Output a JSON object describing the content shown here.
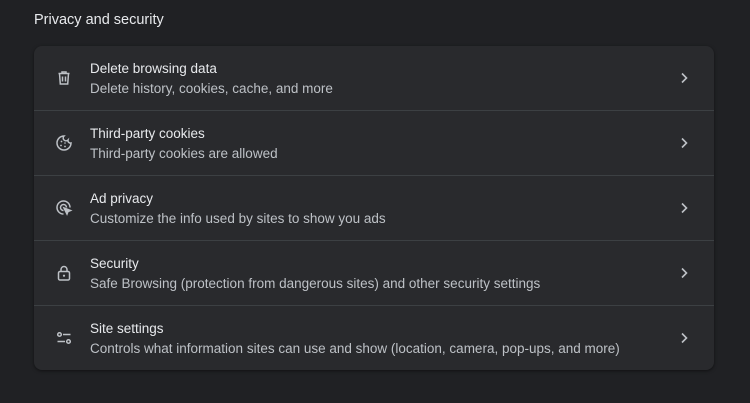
{
  "section": {
    "title": "Privacy and security"
  },
  "rows": [
    {
      "icon": "trash-icon",
      "title": "Delete browsing data",
      "subtitle": "Delete history, cookies, cache, and more"
    },
    {
      "icon": "cookie-icon",
      "title": "Third-party cookies",
      "subtitle": "Third-party cookies are allowed"
    },
    {
      "icon": "ad-privacy-icon",
      "title": "Ad privacy",
      "subtitle": "Customize the info used by sites to show you ads"
    },
    {
      "icon": "lock-icon",
      "title": "Security",
      "subtitle": "Safe Browsing (protection from dangerous sites) and other security settings"
    },
    {
      "icon": "site-settings-icon",
      "title": "Site settings",
      "subtitle": "Controls what information sites can use and show (location, camera, pop-ups, and more)"
    }
  ],
  "colors": {
    "background": "#202124",
    "card": "#292a2d",
    "divider": "#3c4043",
    "primary_text": "#e8eaed",
    "secondary_text": "#bdc1c6",
    "icon": "#bdc1c6"
  }
}
